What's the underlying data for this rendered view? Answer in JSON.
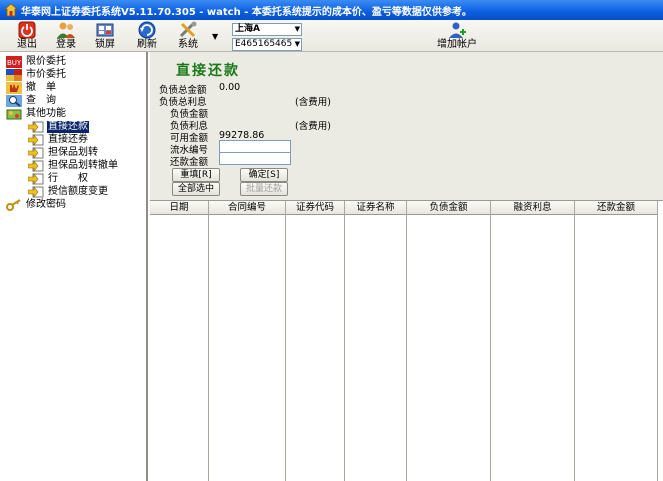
{
  "window": {
    "title": "华泰网上证券委托系统V5.11.70.305 - watch - 本委托系统提示的成本价、盈亏等数据仅供参考。"
  },
  "toolbar": {
    "exit": "退出",
    "login": "登录",
    "lock": "锁屏",
    "refresh": "刷新",
    "system": "系统",
    "market_select": "上海A",
    "account_select": "E465165465",
    "add_account": "增加帐户"
  },
  "tree": {
    "limit_order": "限价委托",
    "market_order": "市价委托",
    "cancel": "撤　单",
    "query": "查　询",
    "other_functions": "其他功能",
    "direct_repay": "直接还款",
    "direct_return_securities": "直接还券",
    "collateral_transfer": "担保品划转",
    "collateral_transfer_cancel": "担保品划转撤单",
    "exercise": "行　　权",
    "credit_limit_change": "授信额度变更",
    "change_password": "修改密码"
  },
  "form": {
    "title": "直接还款",
    "total_debt_label": "负债总金额",
    "total_debt_value": "0.00",
    "total_interest_label": "负债总利息",
    "incl_fee_1": "(含费用)",
    "debt_amount_label": "负债金额",
    "debt_interest_label": "负债利息",
    "incl_fee_2": "(含费用)",
    "available_label": "可用金额",
    "available_value": "99278.86",
    "serial_label": "流水编号",
    "repay_amount_label": "还款金额",
    "reset_btn": "重填[R]",
    "confirm_btn": "确定[S]",
    "select_all_btn": "全部选中",
    "batch_repay_btn": "批量还款"
  },
  "table": {
    "columns": [
      "日期",
      "合同编号",
      "证券代码",
      "证券名称",
      "负债金额",
      "融资利息",
      "还款金额"
    ]
  }
}
